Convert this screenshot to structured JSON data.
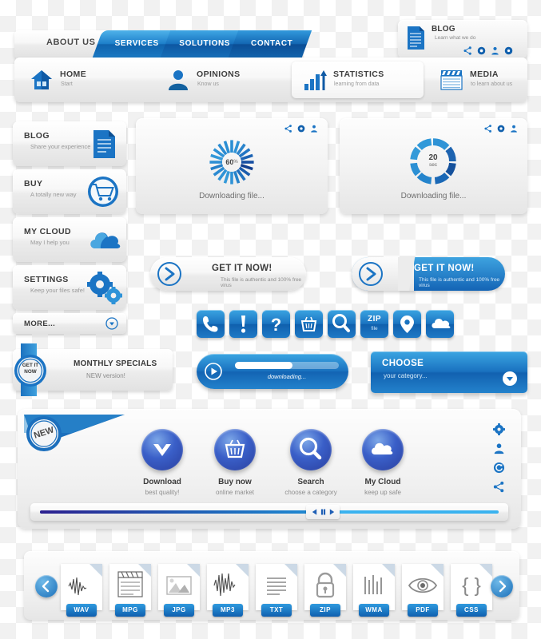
{
  "nav": {
    "brand_label": "ABOUT US",
    "tabs": [
      {
        "label": "SERVICES"
      },
      {
        "label": "SOLUTIONS"
      },
      {
        "label": "CONTACT"
      }
    ]
  },
  "blog_widget": {
    "title": "BLOG",
    "subtitle": "Learn what we do",
    "icons": [
      "share-icon",
      "settings-icon",
      "user-icon",
      "gear-icon"
    ]
  },
  "menubar": {
    "items": [
      {
        "title": "HOME",
        "subtitle": "Start",
        "icon": "house-icon",
        "active": false
      },
      {
        "title": "OPINIONS",
        "subtitle": "Know us",
        "icon": "user-icon",
        "active": false
      },
      {
        "title": "STATISTICS",
        "subtitle": "learning from data",
        "icon": "bar-chart-icon",
        "active": true
      },
      {
        "title": "MEDIA",
        "subtitle": "to learn about us",
        "icon": "clapperboard-icon",
        "active": false
      }
    ]
  },
  "sidebar": {
    "items": [
      {
        "title": "BLOG",
        "subtitle": "Share your experience",
        "icon": "document-icon"
      },
      {
        "title": "BUY",
        "subtitle": "A totally new way",
        "icon": "shopping-cart-icon"
      },
      {
        "title": "MY CLOUD",
        "subtitle": "May I help you",
        "icon": "cloud-icon"
      },
      {
        "title": "SETTINGS",
        "subtitle": "Keep your files safe!",
        "icon": "gears-icon"
      }
    ],
    "more_label": "MORE...",
    "more_icon": "chevron-down-icon"
  },
  "progress_panels": [
    {
      "value": "60",
      "unit": "%",
      "caption": "Downloading file...",
      "style": "spokes"
    },
    {
      "value": "20",
      "unit": "sec",
      "caption": "Downloading file...",
      "style": "ring"
    }
  ],
  "panel_social_icons": [
    "share-icon",
    "settings-icon",
    "user-icon"
  ],
  "cta_buttons": [
    {
      "title": "GET IT NOW!",
      "subtitle": "This file is authentic and 100% free virus",
      "theme": "light",
      "icon": "arrow-right-icon"
    },
    {
      "title": "GET IT NOW!",
      "subtitle": "This file is authentic and 100% free virus",
      "theme": "blue",
      "icon": "arrow-right-icon"
    }
  ],
  "icon_buttons": [
    {
      "name": "phone-icon",
      "label": ""
    },
    {
      "name": "alert-icon",
      "label": ""
    },
    {
      "name": "question-icon",
      "label": ""
    },
    {
      "name": "basket-icon",
      "label": ""
    },
    {
      "name": "search-icon",
      "label": ""
    },
    {
      "name": "zip-file-icon",
      "label": "ZIP",
      "sublabel": "file"
    },
    {
      "name": "location-pin-icon",
      "label": ""
    },
    {
      "name": "cloud-icon",
      "label": ""
    }
  ],
  "monthly_specials": {
    "badge_line1": "GET IT",
    "badge_line2": "NOW",
    "title": "MONTHLY SPECIALS",
    "subtitle": "NEW version!"
  },
  "download_bar": {
    "caption": "downloading...",
    "progress_percent": 55,
    "icon": "play-icon"
  },
  "choose_button": {
    "title": "CHOOSE",
    "subtitle": "your category...",
    "icon": "chevron-down-icon"
  },
  "feature_panel": {
    "ribbon_label": "NEW",
    "features": [
      {
        "title": "Download",
        "subtitle": "best quality!",
        "icon": "download-chevron-icon"
      },
      {
        "title": "Buy now",
        "subtitle": "online market",
        "icon": "basket-icon"
      },
      {
        "title": "Search",
        "subtitle": "choose a category",
        "icon": "search-icon"
      },
      {
        "title": "My Cloud",
        "subtitle": "keep up safe",
        "icon": "cloud-icon"
      }
    ],
    "side_icons": [
      "gear-icon",
      "user-icon",
      "refresh-icon",
      "share-icon"
    ],
    "player": {
      "progress_percent": 60,
      "controls": [
        "prev-icon",
        "pause-icon",
        "play-icon"
      ]
    }
  },
  "file_strip": {
    "prev_label": "prev-arrow-icon",
    "next_label": "next-arrow-icon",
    "files": [
      {
        "label": "WAV",
        "icon": "waveform-icon"
      },
      {
        "label": "MPG",
        "icon": "clapperboard-icon"
      },
      {
        "label": "JPG",
        "icon": "image-icon"
      },
      {
        "label": "MP3",
        "icon": "audio-wave-icon"
      },
      {
        "label": "TXT",
        "icon": "text-lines-icon"
      },
      {
        "label": "ZIP",
        "icon": "lock-icon"
      },
      {
        "label": "WMA",
        "icon": "equalizer-icon"
      },
      {
        "label": "PDF",
        "icon": "eye-icon"
      },
      {
        "label": "CSS",
        "icon": "braces-icon"
      }
    ]
  },
  "colors": {
    "accent_blue": "#1a73c0",
    "light_blue": "#3ea3e0",
    "deep_blue": "#0d57a2",
    "panel_gray": "#f2f2f2"
  }
}
